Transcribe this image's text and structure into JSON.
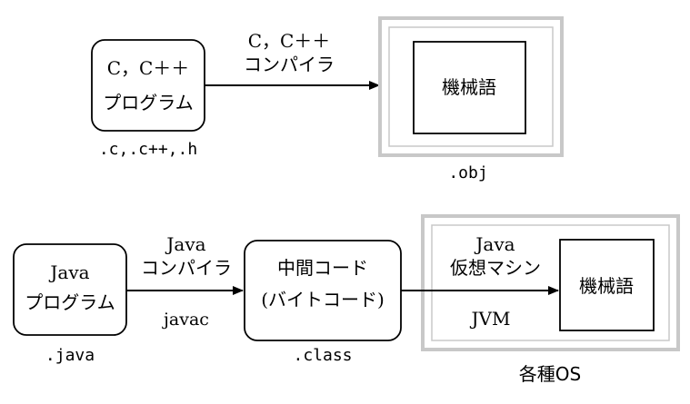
{
  "top": {
    "source_box": {
      "line1": "C，C＋＋",
      "line2": "プログラム"
    },
    "source_ext": ".c,.c++,.h",
    "compiler": {
      "line1": "C，C＋＋",
      "line2": "コンパイラ"
    },
    "machine_code": "機械語",
    "object_ext": ".obj"
  },
  "bottom": {
    "source_box": {
      "line1": "Java",
      "line2": "プログラム"
    },
    "source_ext": ".java",
    "compiler": {
      "line1": "Java",
      "line2": "コンパイラ",
      "command": "javac"
    },
    "intermediate_box": {
      "line1": "中間コード",
      "line2": "(バイトコード)"
    },
    "class_ext": ".class",
    "jvm": {
      "line1": "Java",
      "line2": "仮想マシン",
      "abbr": "JVM"
    },
    "machine_code": "機械語",
    "os_label": "各種OS"
  }
}
